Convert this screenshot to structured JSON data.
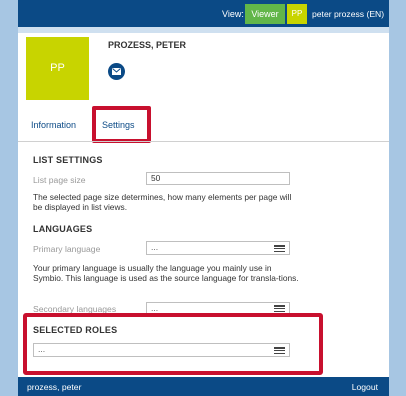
{
  "topbar": {
    "view_label": "View:",
    "viewer_button": "Viewer",
    "avatar_initials": "PP",
    "user_name": "peter prozess (EN)"
  },
  "profile": {
    "avatar_initials": "PP",
    "name": "PROZESS, PETER",
    "mail_icon": "envelope-icon"
  },
  "tabs": [
    {
      "label": "Information"
    },
    {
      "label": "Settings"
    }
  ],
  "list_settings": {
    "title": "LIST SETTINGS",
    "page_size_label": "List page size",
    "page_size_value": "50",
    "help": "The selected page size determines, how many elements per page will be displayed in list views."
  },
  "languages": {
    "title": "LANGUAGES",
    "primary_label": "Primary language",
    "primary_value": "...",
    "help": "Your primary language is usually the language you mainly use in Symbio. This language is used as the source language for transla-tions.",
    "secondary_label": "Secondary languages",
    "secondary_value": "..."
  },
  "selected_roles": {
    "title": "SELECTED ROLES",
    "value": "..."
  },
  "footer": {
    "user": "prozess, peter",
    "logout": "Logout"
  },
  "colors": {
    "brand_blue": "#0b4a86",
    "viewer_green": "#62b649",
    "avatar_lime": "#c8d400",
    "highlight_red": "#c8102e",
    "background": "#a7c6e3"
  }
}
